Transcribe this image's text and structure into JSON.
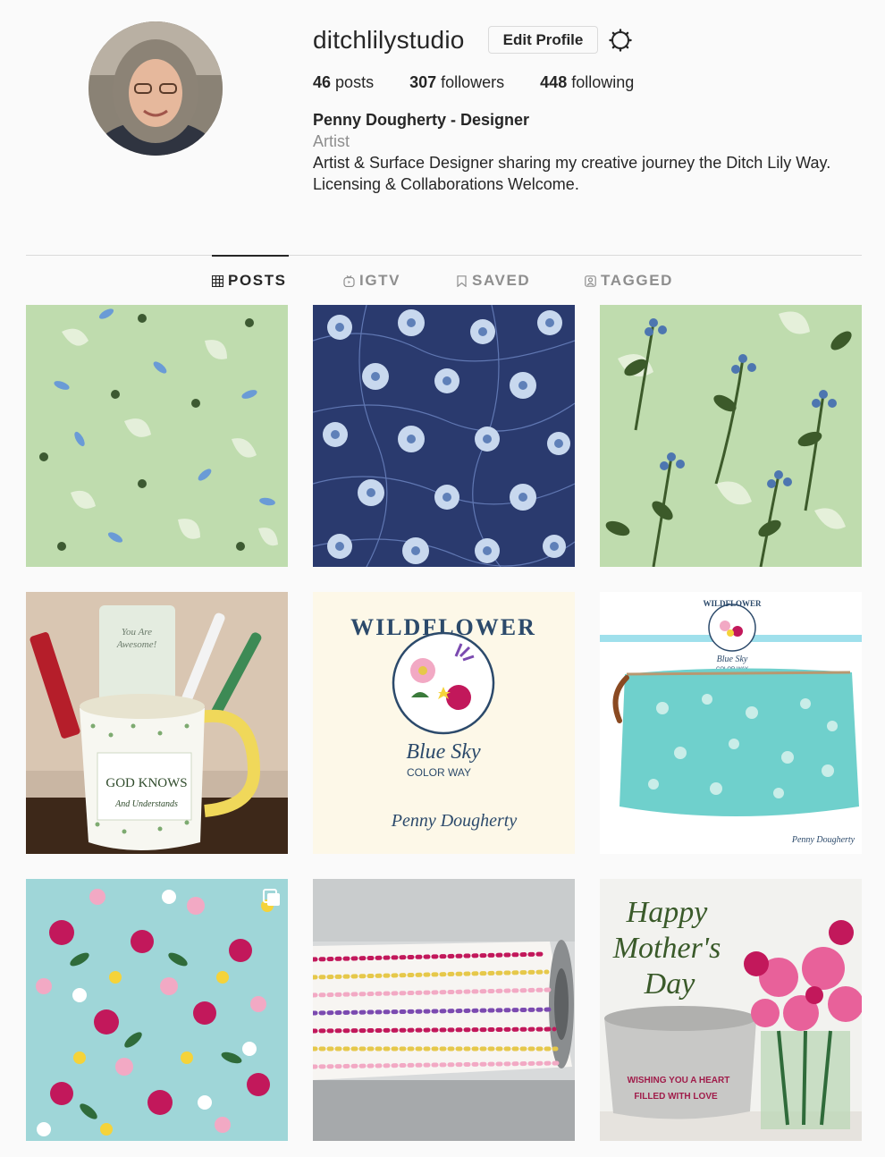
{
  "profile": {
    "username": "ditchlilystudio",
    "edit_label": "Edit Profile",
    "stats": {
      "posts_count": "46",
      "posts_label": "posts",
      "followers_count": "307",
      "followers_label": "followers",
      "following_count": "448",
      "following_label": "following"
    },
    "bio": {
      "name": "Penny Dougherty - Designer",
      "category": "Artist",
      "line1": "Artist & Surface Designer sharing my creative journey the Ditch Lily Way.",
      "line2": "Licensing & Collaborations Welcome."
    }
  },
  "tabs": [
    {
      "label": "POSTS",
      "icon": "grid-icon",
      "active": true
    },
    {
      "label": "IGTV",
      "icon": "igtv-icon",
      "active": false
    },
    {
      "label": "SAVED",
      "icon": "bookmark-icon",
      "active": false
    },
    {
      "label": "TAGGED",
      "icon": "tag-icon",
      "active": false
    }
  ],
  "posts": {
    "mug_text_1": "You Are",
    "mug_text_2": "Awesome!",
    "mug_text_3": "GOD KNOWS",
    "mug_text_4": "And Understands",
    "wildflower_title": "WILDFLOWER",
    "blue_sky": "Blue Sky",
    "color_way": "COLOR WAY",
    "signature": "Penny Dougherty",
    "mothers_1": "Happy",
    "mothers_2": "Mother's",
    "mothers_3": "Day",
    "wishing_1": "WISHING YOU A HEART",
    "wishing_2": "FILLED WITH LOVE"
  },
  "colors": {
    "mint": "#bfdcae",
    "navy": "#2a3a6e",
    "aqua": "#9fd6d8",
    "cream": "#fdf8e8",
    "text_dark": "#262626",
    "text_muted": "#8e8e8e",
    "border": "#dbdbdb"
  }
}
